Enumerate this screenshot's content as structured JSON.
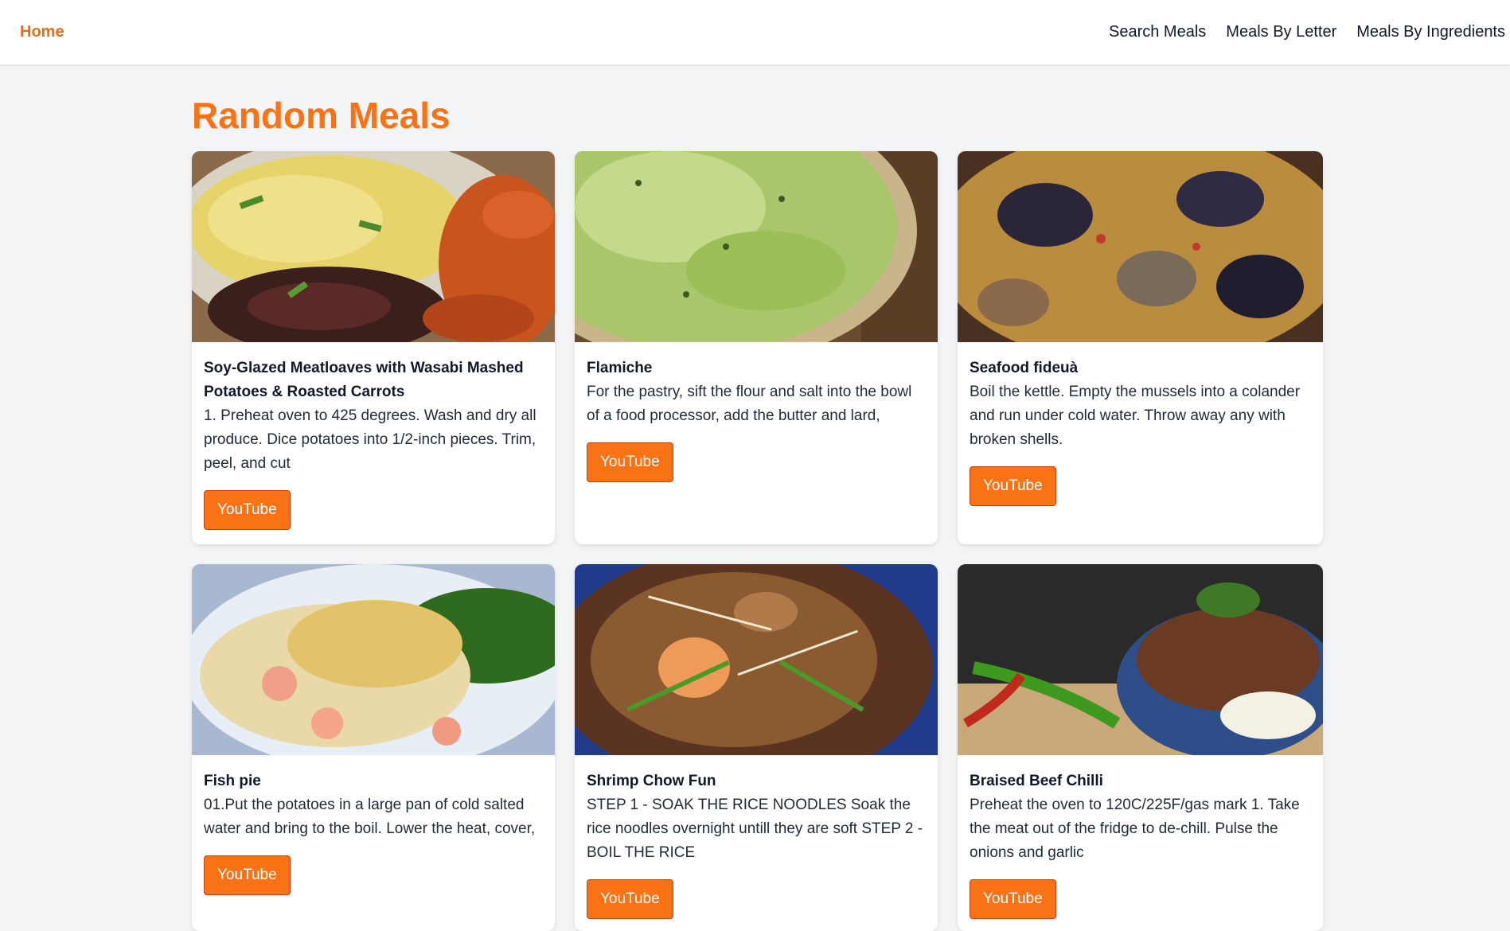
{
  "nav": {
    "home": "Home",
    "links": [
      "Search Meals",
      "Meals By Letter",
      "Meals By Ingredients"
    ]
  },
  "page_title": "Random Meals",
  "meals": [
    {
      "title": "Soy-Glazed Meatloaves with Wasabi Mashed Potatoes & Roasted Carrots",
      "desc": "1. Preheat oven to 425 degrees. Wash and dry all produce. Dice potatoes into 1/2-inch pieces. Trim, peel, and cut",
      "button": "YouTube"
    },
    {
      "title": "Flamiche",
      "desc": "For the pastry, sift the flour and salt into the bowl of a food processor, add the butter and lard,",
      "button": "YouTube"
    },
    {
      "title": "Seafood fideuà",
      "desc": "Boil the kettle. Empty the mussels into a colander and run under cold water. Throw away any with broken shells.",
      "button": "YouTube"
    },
    {
      "title": "Fish pie",
      "desc": "01.Put the potatoes in a large pan of cold salted water and bring to the boil. Lower the heat, cover,",
      "button": "YouTube"
    },
    {
      "title": "Shrimp Chow Fun",
      "desc": "STEP 1 - SOAK THE RICE NOODLES Soak the rice noodles overnight untill they are soft STEP 2 - BOIL THE RICE",
      "button": "YouTube"
    },
    {
      "title": "Braised Beef Chilli",
      "desc": "Preheat the oven to 120C/225F/gas mark 1. Take the meat out of the fridge to de-chill. Pulse the onions and garlic",
      "button": "YouTube"
    }
  ],
  "colors": {
    "accent": "#f97316",
    "home": "#ea6c16",
    "background": "#f3f4f6"
  }
}
